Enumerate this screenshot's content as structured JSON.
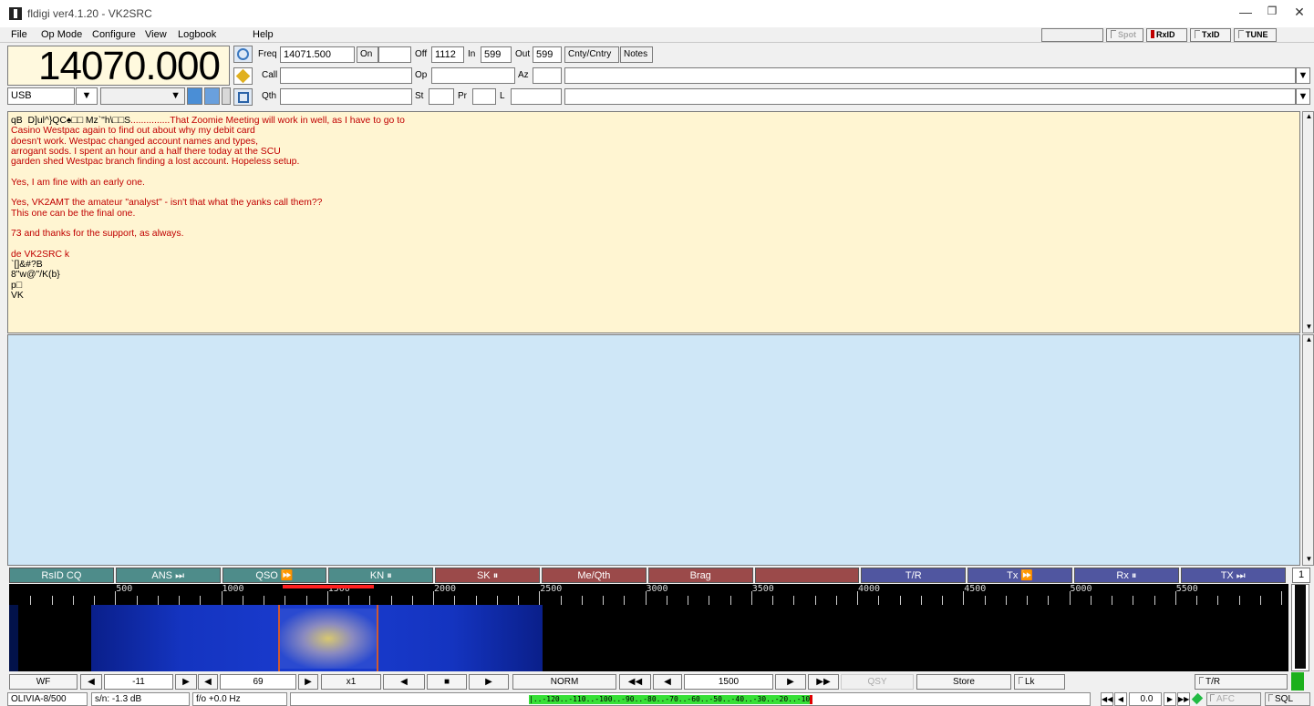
{
  "window": {
    "title": "fldigi ver4.1.20 - VK2SRC"
  },
  "menu": {
    "file": "File",
    "opmode": "Op Mode",
    "configure": "Configure",
    "view": "View",
    "logbook": "Logbook",
    "help": "Help"
  },
  "toolbar": {
    "spot": "Spot",
    "rxid": "RxID",
    "txid": "TxID",
    "tune": "TUNE"
  },
  "freq": {
    "display": "14070.000",
    "mode": "USB"
  },
  "qso": {
    "freq_label": "Freq",
    "freq_value": "14071.500",
    "on_label": "On",
    "off_label": "Off",
    "off_value": "1112",
    "in_label": "In",
    "in_value": "599",
    "out_label": "Out",
    "out_value": "599",
    "cnty_tab": "Cnty/Cntry",
    "notes_tab": "Notes",
    "call_label": "Call",
    "op_label": "Op",
    "az_label": "Az",
    "qth_label": "Qth",
    "st_label": "St",
    "pr_label": "Pr",
    "l_label": "L"
  },
  "rx": {
    "lines": [
      {
        "t": "qB  D]ul^}QC♠□□ Mz`\"h\\□□S",
        "c": "blk"
      },
      {
        "t": "...............That Zoomie Meeting will work in well, as I have to go to",
        "c": "red"
      },
      {
        "t": "Casino Westpac again to find out about why my debit card",
        "c": "red"
      },
      {
        "t": "doesn't work. Westpac changed account names and types,",
        "c": "red"
      },
      {
        "t": "arrogant sods. I spent an hour and a half there today at the SCU",
        "c": "red"
      },
      {
        "t": "garden shed Westpac branch finding a lost account. Hopeless setup.",
        "c": "red"
      },
      {
        "t": "",
        "c": "red"
      },
      {
        "t": "Yes, I am fine with an early one.",
        "c": "red"
      },
      {
        "t": "",
        "c": "red"
      },
      {
        "t": "Yes, VK2AMT the amateur \"analyst\" - isn't that what the yanks call them??",
        "c": "red"
      },
      {
        "t": "This one can be the final one.",
        "c": "red"
      },
      {
        "t": "",
        "c": "red"
      },
      {
        "t": "73 and thanks for the support, as always.",
        "c": "red"
      },
      {
        "t": "",
        "c": "red"
      },
      {
        "t": "de VK2SRC k",
        "c": "red"
      },
      {
        "t": "`[]&#?B",
        "c": "blk"
      },
      {
        "t": "8\"w@\"/K(b}",
        "c": "blk"
      },
      {
        "t": "p□",
        "c": "blk"
      },
      {
        "t": "VK",
        "c": "blk"
      }
    ]
  },
  "macros": [
    {
      "label": "RsID CQ",
      "color": "#4e8c8a"
    },
    {
      "label": "ANS ⏭",
      "color": "#4e8c8a"
    },
    {
      "label": "QSO ⏩",
      "color": "#4e8c8a"
    },
    {
      "label": "KN ⏸",
      "color": "#4e8c8a"
    },
    {
      "label": "SK ⏸",
      "color": "#9b4a4a"
    },
    {
      "label": "Me/Qth",
      "color": "#9b4a4a"
    },
    {
      "label": "Brag",
      "color": "#9b4a4a"
    },
    {
      "label": "",
      "color": "#9b4a4a"
    },
    {
      "label": "T/R",
      "color": "#5056a0"
    },
    {
      "label": "Tx ⏩",
      "color": "#5056a0"
    },
    {
      "label": "Rx ⏸",
      "color": "#5056a0"
    },
    {
      "label": "TX ⏭",
      "color": "#5056a0"
    }
  ],
  "macro_set": "1",
  "scale_ticks": [
    "500",
    "1000",
    "1500",
    "2000",
    "2500",
    "3000",
    "3500",
    "4000",
    "4500",
    "5000",
    "5500"
  ],
  "bottom": {
    "wf": "WF",
    "ref": "-11",
    "range": "69",
    "zoom": "x1",
    "speed": "NORM",
    "cfreq": "1500",
    "qsy": "QSY",
    "store": "Store",
    "lk": "Lk",
    "tr": "T/R"
  },
  "status": {
    "mode": "OLIVIA-8/500",
    "sn": "s/n: -1.3 dB",
    "fo": "f/o +0.0 Hz",
    "meter": "|..-120..-110..-100..-90..-80..-70..-60..-50..-40..-30..-20..-10...|",
    "afc_val": "0.0",
    "afc": "AFC",
    "sql": "SQL"
  },
  "colors": {
    "rx_bg": "#fff5d2",
    "tx_bg": "#cfe7f7",
    "rx_text": "#c00000"
  }
}
